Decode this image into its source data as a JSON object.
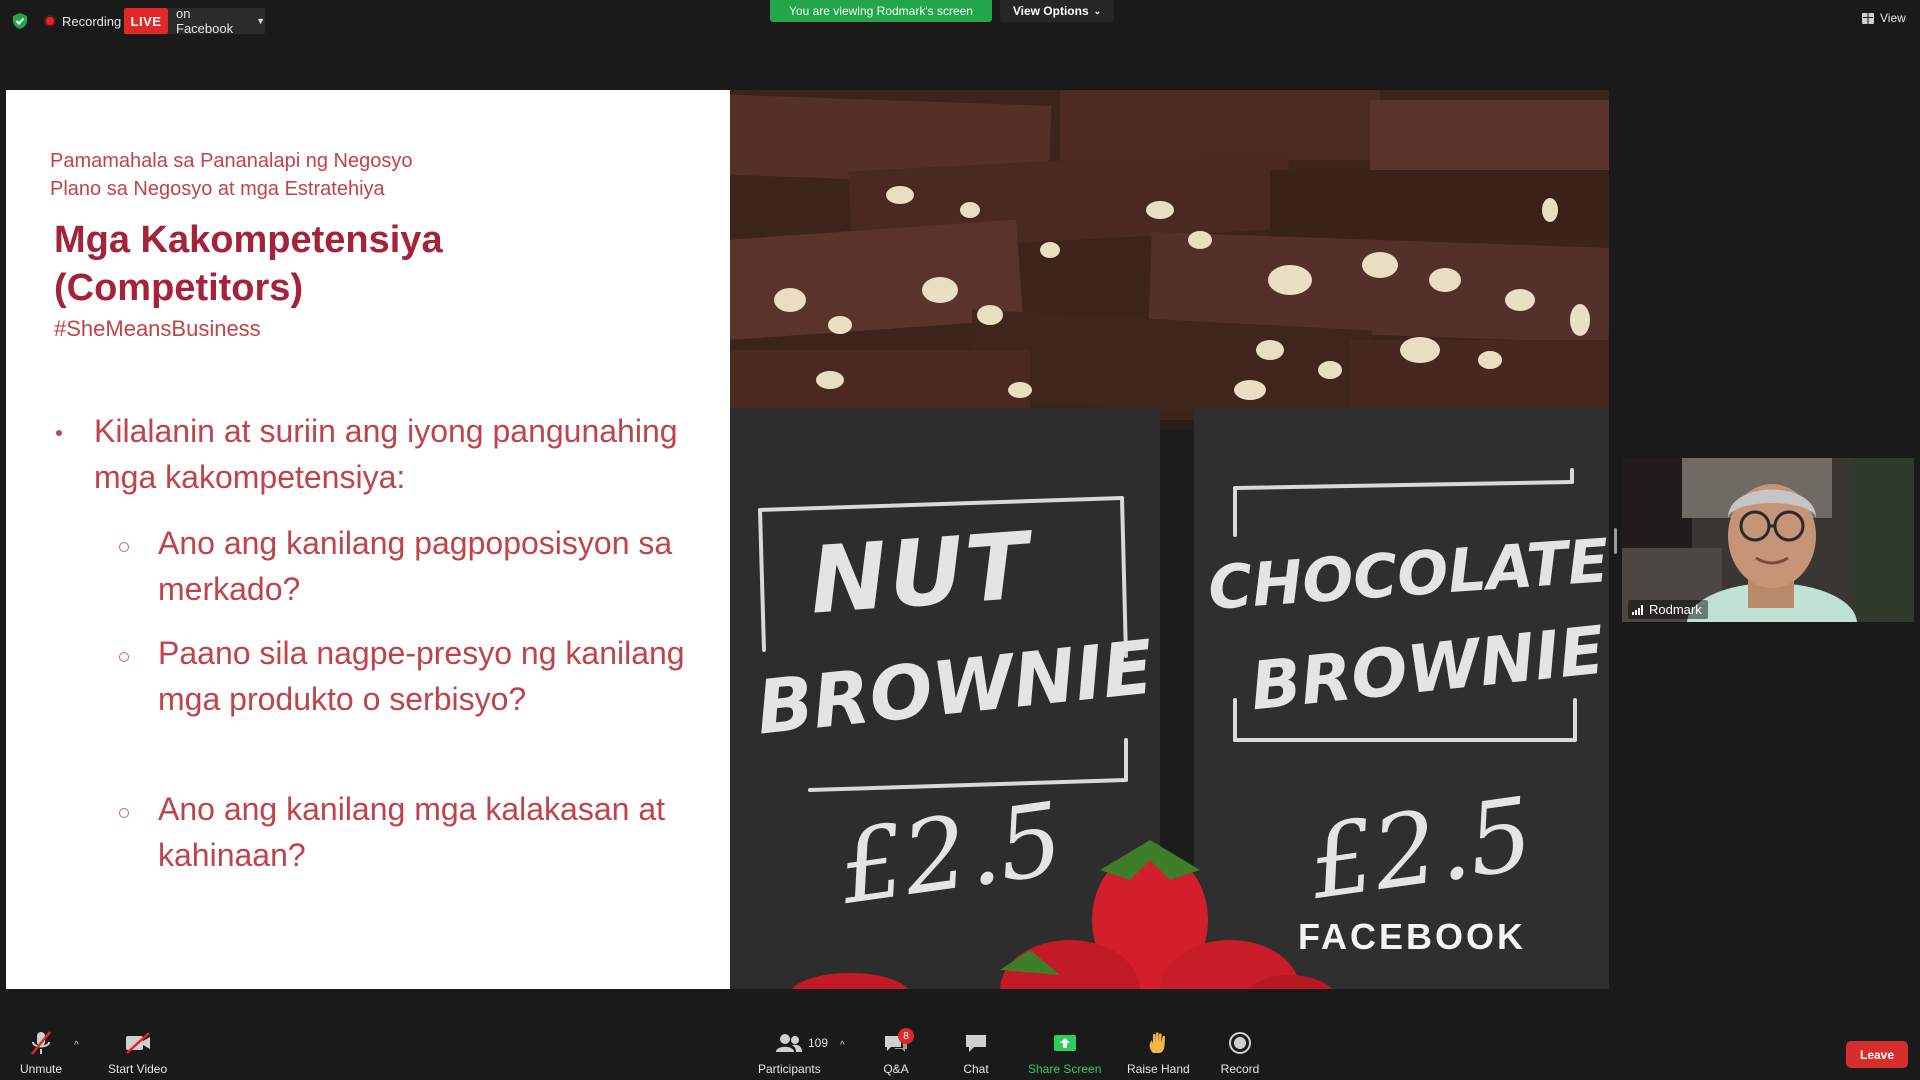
{
  "topbar": {
    "recording_label": "Recording",
    "live_label": "LIVE",
    "stream_target": "on Facebook",
    "viewing_banner": "You are viewing Rodmark's screen",
    "view_options_label": "View Options",
    "view_label": "View"
  },
  "slide": {
    "subhead_1": "Pamamahala sa Pananalapi ng Negosyo",
    "subhead_2": "Plano sa Negosyo at mga Estratehiya",
    "title_line_1": "Mga Kakompetensiya",
    "title_line_2": "(Competitors)",
    "hashtag": "#SheMeansBusiness",
    "bullet": "Kilalanin at suriin ang iyong pangunahing mga kakompetensiya:",
    "sub_bullets": [
      "Ano ang kanilang pagpoposisyon sa merkado?",
      "Paano sila nagpe-presyo ng kanilang mga produkto o serbisyo?",
      "Ano ang kanilang mga kalakasan at kahinaan?"
    ],
    "sign_left_line_1": "NUT",
    "sign_left_line_2": "BROWNIE",
    "sign_left_price": "£2.5",
    "sign_right_line_1": "CHOCOLATE",
    "sign_right_line_2": "BROWNIE",
    "sign_right_price": "£2.5",
    "brand_mark": "FACEBOOK"
  },
  "participant": {
    "name": "Rodmark"
  },
  "toolbar": {
    "unmute": "Unmute",
    "start_video": "Start Video",
    "participants": "Participants",
    "participant_count": "109",
    "qa": "Q&A",
    "qa_badge": "8",
    "chat": "Chat",
    "share_screen": "Share Screen",
    "raise_hand": "Raise Hand",
    "record": "Record",
    "leave": "Leave"
  },
  "colors": {
    "live_red": "#e02828",
    "banner_green": "#23a64a",
    "slide_text": "#c0434a",
    "slide_title": "#a3233a",
    "share_green": "#2fcc5a"
  }
}
